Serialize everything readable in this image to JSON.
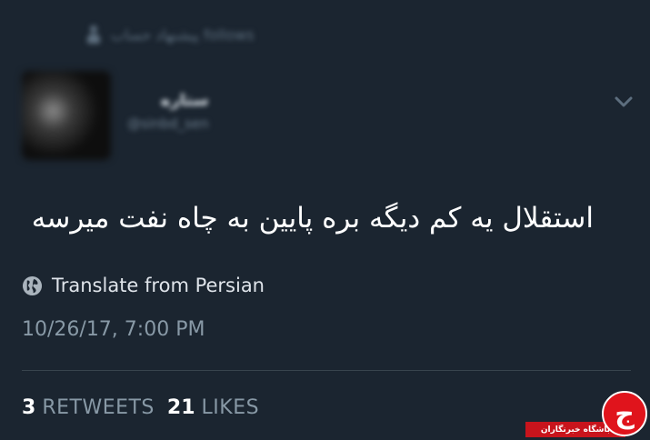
{
  "social_context": {
    "text": "پیشنهاد حساب follows",
    "icon": "person-icon"
  },
  "author": {
    "name": "ستاره",
    "handle": "@sinbd_sen",
    "avatar_icon": "avatar"
  },
  "menu": {
    "icon": "chevron-down-icon"
  },
  "tweet": {
    "text": "استقلال یه کم دیگه بره پایین به چاه نفت میرسه"
  },
  "translate": {
    "label": "Translate from Persian",
    "icon": "globe-icon"
  },
  "timestamp": "10/26/17, 7:00 PM",
  "stats": {
    "retweets_count": "3",
    "retweets_label": "RETWEETS",
    "likes_count": "21",
    "likes_label": "LIKES"
  },
  "watermark": {
    "text": "باشگاه خبرنگاران",
    "glyph": "ج"
  },
  "colors": {
    "background": "#1b2530",
    "text_primary": "#ffffff",
    "text_secondary": "#8899a6",
    "divider": "#38444d",
    "watermark_red": "#e0141c"
  }
}
